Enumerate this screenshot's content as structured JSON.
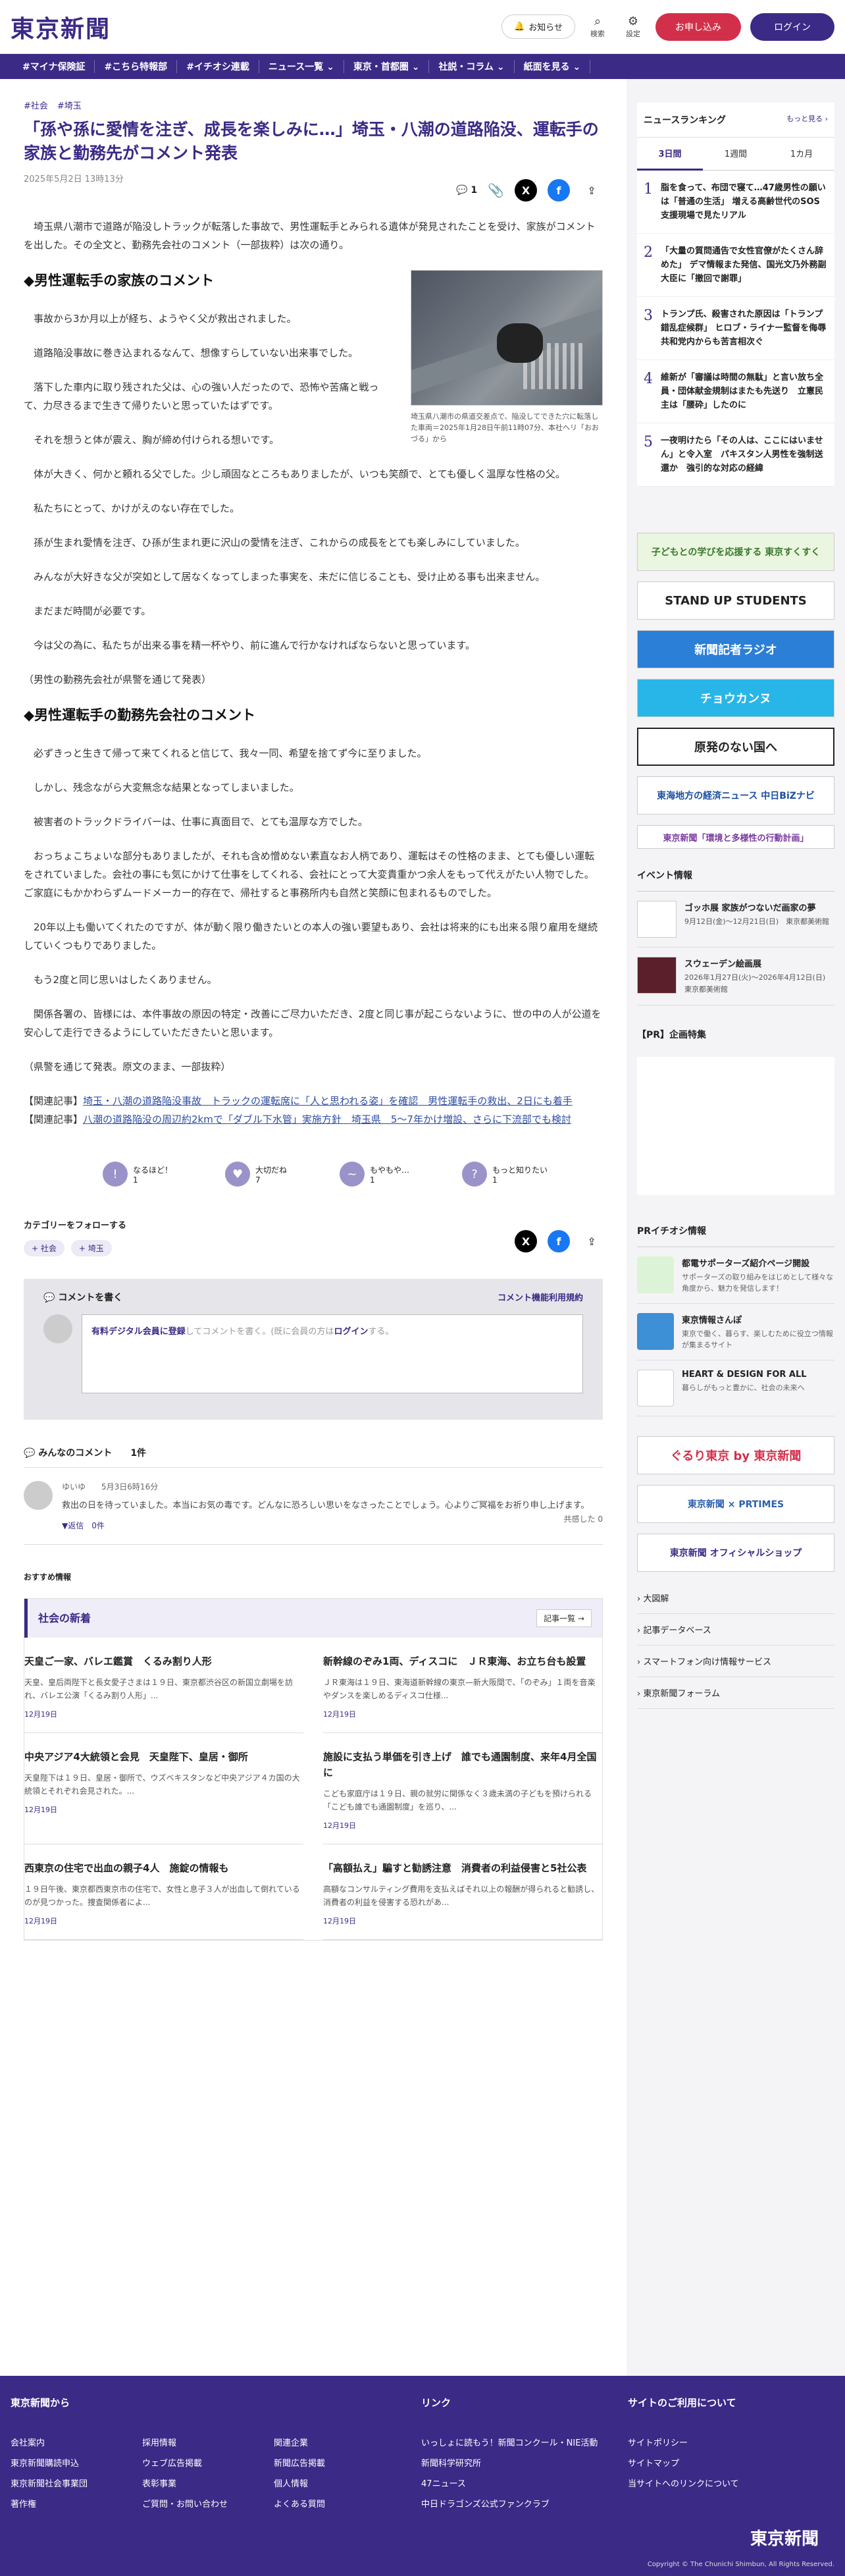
{
  "header": {
    "logo": "東京新聞",
    "notify": "お知らせ",
    "search": "検索",
    "settings": "設定",
    "subscribe": "お申し込み",
    "login": "ログイン"
  },
  "nav": [
    "#マイナ保険証",
    "#こちら特報部",
    "#イチオシ連載",
    "ニュース一覧 ⌄",
    "東京・首都圏 ⌄",
    "社説・コラム ⌄",
    "紙面を見る ⌄"
  ],
  "article": {
    "tags": [
      "#社会",
      "#埼玉"
    ],
    "title": "「孫や孫に愛情を注ぎ、成長を楽しみに…」埼玉・八潮の道路陥没、運転手の家族と勤務先がコメント発表",
    "date": "2025年5月2日 13時13分",
    "comment_count": "1",
    "caption": "埼玉県八潮市の県道交差点で、陥没してできた穴に転落した車両＝2025年1月28日午前11時07分、本社ヘリ「おおづる」から",
    "intro": "埼玉県八潮市で道路が陥没しトラックが転落した事故で、男性運転手とみられる遺体が発見されたことを受け、家族がコメントを出した。その全文と、勤務先会社のコメント（一部抜粋）は次の通り。",
    "h_family": "◆男性運転手の家族のコメント",
    "family": [
      "事故から3か月以上が経ち、ようやく父が救出されました。",
      "道路陥没事故に巻き込まれるなんて、想像すらしていない出来事でした。",
      "落下した車内に取り残された父は、心の強い人だったので、恐怖や苦痛と戦って、力尽きるまで生きて帰りたいと思っていたはずです。",
      "それを想うと体が震え、胸が締め付けられる想いです。",
      "体が大きく、何かと頼れる父でした。少し頑固なところもありましたが、いつも笑顔で、とても優しく温厚な性格の父。",
      "私たちにとって、かけがえのない存在でした。",
      "孫が生まれ愛情を注ぎ、ひ孫が生まれ更に沢山の愛情を注ぎ、これからの成長をとても楽しみにしていました。",
      "みんなが大好きな父が突如として居なくなってしまった事実を、未だに信じることも、受け止める事も出来ません。",
      "まだまだ時間が必要です。",
      "今は父の為に、私たちが出来る事を精一杯やり、前に進んで行かなければならないと思っています。"
    ],
    "family_note": "（男性の勤務先会社が県警を通じて発表）",
    "h_company": "◆男性運転手の勤務先会社のコメント",
    "company": [
      "必ずきっと生きて帰って来てくれると信じて、我々一同、希望を捨てず今に至りました。",
      "しかし、残念ながら大変無念な結果となってしまいました。",
      "被害者のトラックドライバーは、仕事に真面目で、とても温厚な方でした。",
      "おっちょこちょいな部分もありましたが、それも含め憎めない素直なお人柄であり、運転はその性格のまま、とても優しい運転をされていました。会社の事にも気にかけて仕事をしてくれる、会社にとって大変貴重かつ余人をもって代えがたい人物でした。ご家庭にもかかわらずムードメーカー的存在で、帰社すると事務所内も自然と笑顔に包まれるものでした。",
      "20年以上も働いてくれたのですが、体が動く限り働きたいとの本人の強い要望もあり、会社は将来的にも出来る限り雇用を継続していくつもりでありました。",
      "もう2度と同じ思いはしたくありません。",
      "関係各署の、皆様には、本件事故の原因の特定・改善にご尽力いただき、2度と同じ事が起こらないように、世の中の人が公道を安心して走行できるようにしていただきたいと思います。"
    ],
    "company_note": "（県警を通じて発表。原文のまま、一部抜粋）",
    "related": [
      {
        "prefix": "【関連記事】",
        "text": "埼玉・八潮の道路陥没事故　トラックの運転席に「人と思われる姿」を確認　男性運転手の救出、2日にも着手"
      },
      {
        "prefix": "【関連記事】",
        "text": "八潮の道路陥没の周辺約2kmで「ダブル下水管」実施方針　埼玉県　5〜7年かけ増設、さらに下流部でも検討"
      }
    ]
  },
  "reactions": [
    {
      "label": "なるほど！",
      "count": "1"
    },
    {
      "label": "大切だね",
      "count": "7"
    },
    {
      "label": "もやもや…",
      "count": "1"
    },
    {
      "label": "もっと知りたい",
      "count": "1"
    }
  ],
  "follow": {
    "title": "カテゴリーをフォローする",
    "chips": [
      "+ 社会",
      "+ 埼玉"
    ]
  },
  "comment_box": {
    "title": "コメントを書く",
    "rules": "コメント機能利用規約",
    "link": "有料デジタル会員に登録",
    "rest": "してコメントを書く。(既に会員の方は",
    "login": "ログイン",
    "end": "する。"
  },
  "comments": {
    "title": "みんなのコメント",
    "count": "1件",
    "items": [
      {
        "user": "ゆいゆ",
        "time": "5月3日6時16分",
        "text": "救出の日を待っていました。本当にお気の毒です。どんなに恐ろしい思いをなさったことでしょう。心よりご冥福をお祈り申し上げます。",
        "reply": "▼返信　0件",
        "agree": "共感した 0"
      }
    ]
  },
  "recommend": "おすすめ情報",
  "news": {
    "title": "社会の新着",
    "more": "記事一覧 →",
    "items": [
      {
        "title": "天皇ご一家、バレエ鑑賞　くるみ割り人形",
        "summary": "天皇、皇后両陛下と長女愛子さまは１９日、東京都渋谷区の新国立劇場を訪れ、バレエ公演「くるみ割り人形」...",
        "date": "12月19日"
      },
      {
        "title": "新幹線のぞみ1両、ディスコに　ＪＲ東海、お立ち台も設置",
        "summary": "ＪＲ東海は１９日、東海道新幹線の東京—新大阪間で、「のぞみ」１両を音楽やダンスを楽しめるディスコ仕様...",
        "date": "12月19日"
      },
      {
        "title": "中央アジア4大統領と会見　天皇陛下、皇居・御所",
        "summary": "天皇陛下は１９日、皇居・御所で、ウズベキスタンなど中央アジア４カ国の大統領とそれぞれ会見された。...",
        "date": "12月19日"
      },
      {
        "title": "施設に支払う単価を引き上げ　誰でも通園制度、来年4月全国に",
        "summary": "こども家庭庁は１９日、親の就労に関係なく３歳未満の子どもを預けられる「こども誰でも通園制度」を巡り、...",
        "date": "12月19日"
      },
      {
        "title": "西東京の住宅で出血の親子4人　施錠の情報も",
        "summary": "１９日午後、東京都西東京市の住宅で、女性と息子３人が出血して倒れているのが見つかった。捜査関係者によ...",
        "date": "12月19日"
      },
      {
        "title": "「高額払え」騙すと勧誘注意　消費者の利益侵害と5社公表",
        "summary": "高額なコンサルティング費用を支払えばそれ以上の報酬が得られると勧誘し、消費者の利益を侵害する恐れがあ...",
        "date": "12月19日"
      }
    ]
  },
  "ranking": {
    "title": "ニュースランキング",
    "more": "もっと見る ›",
    "tabs": [
      "3日間",
      "1週間",
      "1カ月"
    ],
    "items": [
      "脂を食って、布団で寝て…47歳男性の願いは「普通の生活」 増える高齢世代のSOS　支援現場で見たリアル",
      "「大量の質問通告で女性官僚がたくさん辞めた」 デマ情報また発信、国光文乃外務副大臣に「撤回で謝罪」",
      "トランプ氏、殺害された原因は「トランプ錯乱症候群」 ヒロブ・ライナー監督を侮辱 共和党内からも苦言相次ぐ",
      "維新が「審議は時間の無駄」と言い放ち全員・団体献金規制はまたも先送り　立憲民主は「腰砕」したのに",
      "一夜明けたら「その人は、ここにはいません」と令入室　パキスタン人男性を強制送還か　強引的な対応の経緯"
    ]
  },
  "banners": [
    "子どもとの学びを応援する 東京すくすく",
    "STAND UP STUDENTS",
    "新聞記者ラジオ",
    "チョウカンヌ",
    "原発のない国へ",
    "東海地方の経済ニュース 中日BiZナビ",
    "東京新聞「環境と多様性の行動計画」"
  ],
  "events": {
    "title": "イベント情報",
    "items": [
      {
        "title": "ゴッホ展 家族がつないだ画家の夢",
        "date": "9月12日(金)〜12月21日(日)　東京都美術館"
      },
      {
        "title": "スウェーデン絵画展",
        "date": "2026年1月27日(火)〜2026年4月12日(日)　東京都美術館"
      }
    ]
  },
  "pr": "【PR】企画特集",
  "pickup": {
    "title": "PRイチオシ情報",
    "items": [
      {
        "title": "都電サポーターズ紹介ページ開設",
        "desc": "サポーターズの取り組みをはじめとして様々な角度から、魅力を発信します！"
      },
      {
        "title": "東京情報さんぽ",
        "desc": "東京で働く、暮らす、楽しむために役立つ情報が集まるサイト"
      },
      {
        "title": "HEART & DESIGN FOR ALL",
        "desc": "暮らしがもっと豊かに、社会の未来へ"
      }
    ]
  },
  "banners2": [
    "ぐるり東京 by 東京新聞",
    "東京新聞 × PRTIMES",
    "東京新聞 オフィシャルショップ"
  ],
  "sidelinks": [
    "大図解",
    "記事データベース",
    "スマートフォン向け情報サービス",
    "東京新聞フォーラム"
  ],
  "footer": {
    "c1_title": "東京新聞から",
    "c1": [
      "会社案内",
      "採用情報",
      "関連企業",
      "東京新聞購読申込",
      "ウェブ広告掲載",
      "新聞広告掲載",
      "東京新聞社会事業団",
      "表彰事業",
      "個人情報",
      "著作権",
      "ご質問・お問い合わせ",
      "よくある質問"
    ],
    "c2_title": "リンク",
    "c2": [
      "いっしょに読もう！新聞コンクール・NIE活動",
      "新聞科学研究所",
      "47ニュース",
      "中日ドラゴンズ公式ファンクラブ"
    ],
    "c3_title": "サイトのご利用について",
    "c3": [
      "サイトポリシー",
      "サイトマップ",
      "当サイトへのリンクについて"
    ],
    "logo": "東京新聞",
    "copy": "Copyright © The Chunichi Shimbun, All Rights Reserved."
  }
}
